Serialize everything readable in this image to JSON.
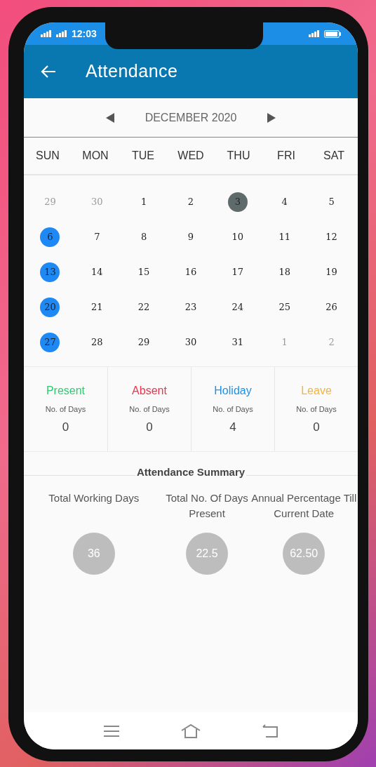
{
  "status_bar": {
    "time": "12:03"
  },
  "app_bar": {
    "title": "Attendance"
  },
  "month_nav": {
    "label": "DECEMBER 2020"
  },
  "weekdays": [
    "SUN",
    "MON",
    "TUE",
    "WED",
    "THU",
    "FRI",
    "SAT"
  ],
  "days": [
    {
      "label": "29",
      "kind": "other"
    },
    {
      "label": "30",
      "kind": "other"
    },
    {
      "label": "1",
      "kind": "normal"
    },
    {
      "label": "2",
      "kind": "normal"
    },
    {
      "label": "3",
      "kind": "today"
    },
    {
      "label": "4",
      "kind": "normal"
    },
    {
      "label": "5",
      "kind": "normal"
    },
    {
      "label": "6",
      "kind": "holiday"
    },
    {
      "label": "7",
      "kind": "normal"
    },
    {
      "label": "8",
      "kind": "normal"
    },
    {
      "label": "9",
      "kind": "normal"
    },
    {
      "label": "10",
      "kind": "normal"
    },
    {
      "label": "11",
      "kind": "normal"
    },
    {
      "label": "12",
      "kind": "normal"
    },
    {
      "label": "13",
      "kind": "holiday"
    },
    {
      "label": "14",
      "kind": "normal"
    },
    {
      "label": "15",
      "kind": "normal"
    },
    {
      "label": "16",
      "kind": "normal"
    },
    {
      "label": "17",
      "kind": "normal"
    },
    {
      "label": "18",
      "kind": "normal"
    },
    {
      "label": "19",
      "kind": "normal"
    },
    {
      "label": "20",
      "kind": "holiday"
    },
    {
      "label": "21",
      "kind": "normal"
    },
    {
      "label": "22",
      "kind": "normal"
    },
    {
      "label": "23",
      "kind": "normal"
    },
    {
      "label": "24",
      "kind": "normal"
    },
    {
      "label": "25",
      "kind": "normal"
    },
    {
      "label": "26",
      "kind": "normal"
    },
    {
      "label": "27",
      "kind": "holiday"
    },
    {
      "label": "28",
      "kind": "normal"
    },
    {
      "label": "29",
      "kind": "normal"
    },
    {
      "label": "30",
      "kind": "normal"
    },
    {
      "label": "31",
      "kind": "normal"
    },
    {
      "label": "1",
      "kind": "other"
    },
    {
      "label": "2",
      "kind": "other"
    }
  ],
  "stats": [
    {
      "title": "Present",
      "color": "#2ecc71",
      "caption": "No. of Days",
      "value": "0"
    },
    {
      "title": "Absent",
      "color": "#f0324b",
      "caption": "No. of Days",
      "value": "0"
    },
    {
      "title": "Holiday",
      "color": "#1e90e6",
      "caption": "No. of Days",
      "value": "4"
    },
    {
      "title": "Leave",
      "color": "#f2b540",
      "caption": "No. of Days",
      "value": "0"
    }
  ],
  "summary": {
    "title": "Attendance Summary",
    "items": [
      {
        "label": "Total Working Days",
        "value": "36"
      },
      {
        "label": "Total No. Of Days Present",
        "value": "22.5"
      },
      {
        "label": "Annual Percentage Till Current Date",
        "value": "62.50"
      }
    ]
  }
}
